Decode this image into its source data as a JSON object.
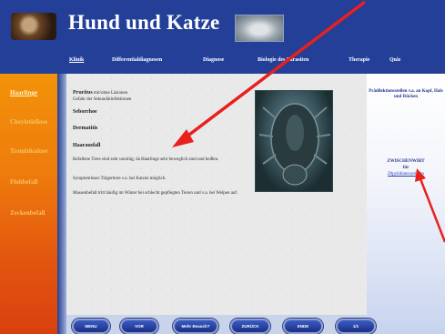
{
  "header": {
    "title": "Hund und Katze"
  },
  "nav": {
    "items": [
      {
        "label": "Klinik",
        "active": true
      },
      {
        "label": "Differentialdiagnosen",
        "active": false
      },
      {
        "label": "Diagnose",
        "active": false
      },
      {
        "label": "Biologie des Parasiten",
        "active": false
      },
      {
        "label": "Therapie",
        "active": false
      },
      {
        "label": "Quiz",
        "active": false
      }
    ]
  },
  "sidebar": {
    "items": [
      {
        "label": "Haarlinge",
        "active": true
      },
      {
        "label": "Cheyletiellose",
        "active": false
      },
      {
        "label": "Trombikulose",
        "active": false
      },
      {
        "label": "Flohbefall",
        "active": false
      },
      {
        "label": "Zeckenbefall",
        "active": false
      }
    ]
  },
  "content": {
    "pruritus_bold": "Pruritus",
    "pruritus_rest": " mit/ohne Läsionen",
    "pruritus_line2": "Gefahr der Sekundärinfektionen",
    "seborrhoe": "Seborrhoe",
    "dermatitis": "Dermatitis",
    "haarausfall": "Haarausfall",
    "p1": "Befallene Tiere sind sehr unruhig, da Haarlinge sehr beweglich sind und beißen.",
    "p2": "Symptomloses Trägertiere v.a. bei Katzen möglich.",
    "p3": "Massenbefall tritt häufig im Winter bei schlecht gepflegten Tieren und v.a. bei Welpen auf."
  },
  "right_panel": {
    "predilection": "Prädilektionsstellen v.a. an Kopf, Hals und Rücken",
    "intermediate": "ZWISCHENWIRT",
    "fuer": "für",
    "link": "Dipylidiumcaninum"
  },
  "buttons": [
    "MENU",
    "VOR",
    "Mehr Beauch?",
    "ZURÜCK",
    "ENDE",
    "1/1"
  ],
  "colors": {
    "header_blue": "#233f98",
    "sidebar_orange": "#ee7a0c",
    "arrow_red": "#e8201f"
  }
}
